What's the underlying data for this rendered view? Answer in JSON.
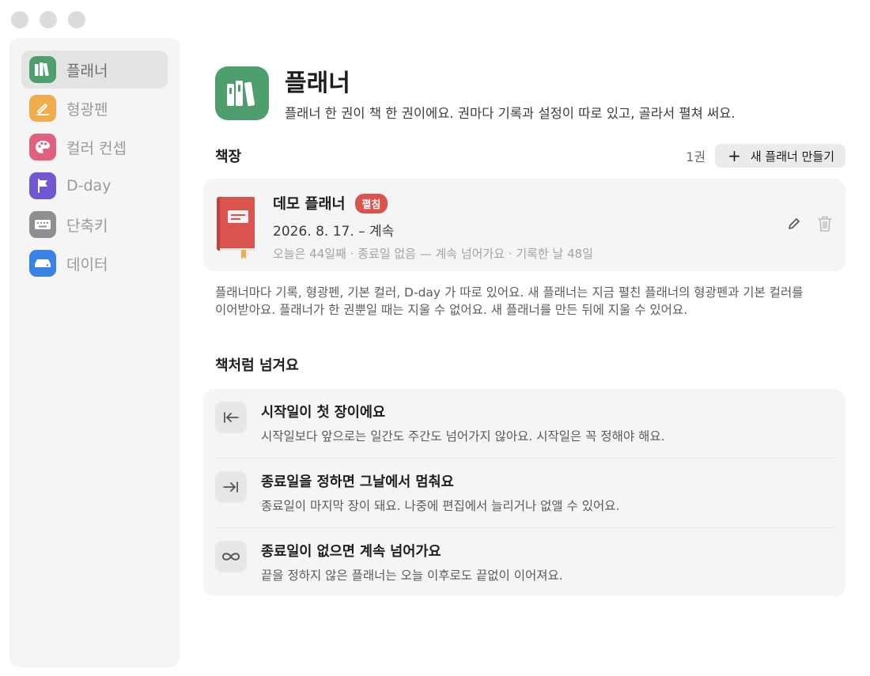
{
  "sidebar": {
    "items": [
      {
        "label": "플래너",
        "icon": "planner-books-icon",
        "color": "#4f9e6e",
        "active": true
      },
      {
        "label": "형광펜",
        "icon": "highlighter-pen-icon",
        "color": "#f0ad4e",
        "active": false
      },
      {
        "label": "컬러 컨셉",
        "icon": "palette-icon",
        "color": "#e0607e",
        "active": false
      },
      {
        "label": "D-day",
        "icon": "flag-icon",
        "color": "#7257d1",
        "active": false
      },
      {
        "label": "단축키",
        "icon": "keyboard-icon",
        "color": "#8e8e93",
        "active": false
      },
      {
        "label": "데이터",
        "icon": "drive-icon",
        "color": "#3a82e4",
        "active": false
      }
    ]
  },
  "header": {
    "title": "플래너",
    "subtitle": "플래너 한 권이 책 한 권이에요. 권마다 기록과 설정이 따로 있고, 골라서 펼쳐 써요."
  },
  "bookshelf": {
    "title": "책장",
    "count": "1권",
    "new_button": "새 플래너 만들기",
    "books": [
      {
        "name": "데모 플래너",
        "badge": "펼침",
        "date_range": "2026. 8. 17. – 계속",
        "meta": "오늘은 44일째 · 종료일 없음 — 계속 넘어가요 · 기록한 날 48일",
        "cover_color": "#d9534f"
      }
    ],
    "description": "플래너마다 기록, 형광펜, 기본 컬러, D-day 가 따로 있어요. 새 플래너는 지금 펼친 플래너의 형광펜과 기본 컬러를 이어받아요. 플래너가 한 권뿐일 때는 지울 수 없어요. 새 플래너를 만든 뒤에 지울 수 있어요."
  },
  "paging": {
    "title": "책처럼 넘겨요",
    "rules": [
      {
        "icon": "arrow-to-start-icon",
        "title": "시작일이 첫 장이에요",
        "subtitle": "시작일보다 앞으로는 일간도 주간도 넘어가지 않아요. 시작일은 꼭 정해야 해요."
      },
      {
        "icon": "arrow-to-end-icon",
        "title": "종료일을 정하면 그날에서 멈춰요",
        "subtitle": "종료일이 마지막 장이 돼요. 나중에 편집에서 늘리거나 없앨 수 있어요."
      },
      {
        "icon": "infinity-icon",
        "title": "종료일이 없으면 계속 넘어가요",
        "subtitle": "끝을 정하지 않은 플래너는 오늘 이후로도 끝없이 이어져요."
      }
    ]
  },
  "colors": {
    "accent_green": "#4f9e6e",
    "badge_red": "#d9534f"
  }
}
